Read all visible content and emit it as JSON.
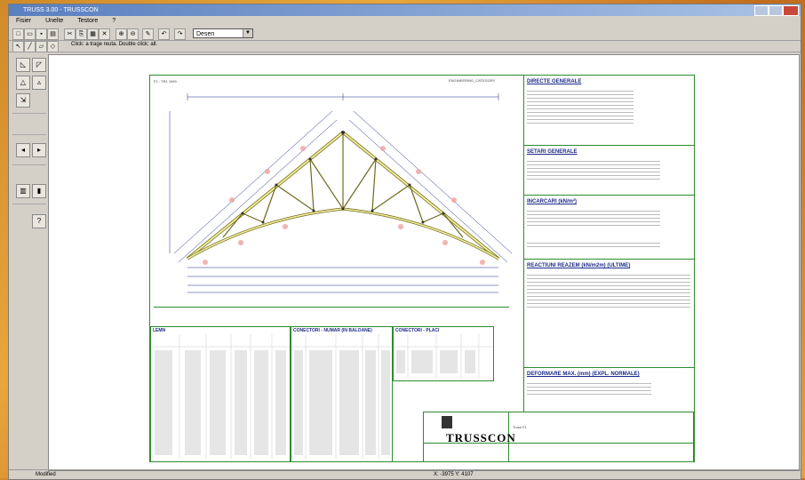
{
  "window": {
    "title": "TRUSS 3.00 - TRUSSCON"
  },
  "menu": [
    "Fisier",
    "Unelte",
    "Testore",
    "?"
  ],
  "toolbar": {
    "view_select": "Desen"
  },
  "hint": "Click: a trage reuta. Double click: alt.",
  "drawing": {
    "sheet_label": "F1 - TR1 1999",
    "scale_note": "ENGINEERING_CATEGORY",
    "sections": {
      "general": "DIRECTE GENERALE",
      "settings": "SETARI GENERALE",
      "loads": "INCARCARI (kN/m²)",
      "reactions": "REACTIUNI REAZEM (kN/m2m) (ULTIME)",
      "deflection": "DEFORMARE MAX. (mm) (EXPL. NORMALE)"
    },
    "tables": {
      "wood": "LEMN",
      "connectors": "CONECTORI - NUMAR (IN BALOANE)",
      "connectors2": "CONECTORI - PLACI"
    },
    "brand": "TRUSSCON",
    "project": "Truss F1"
  },
  "status": {
    "left": "Modified",
    "right": "X: -3975  Y: 4107"
  }
}
